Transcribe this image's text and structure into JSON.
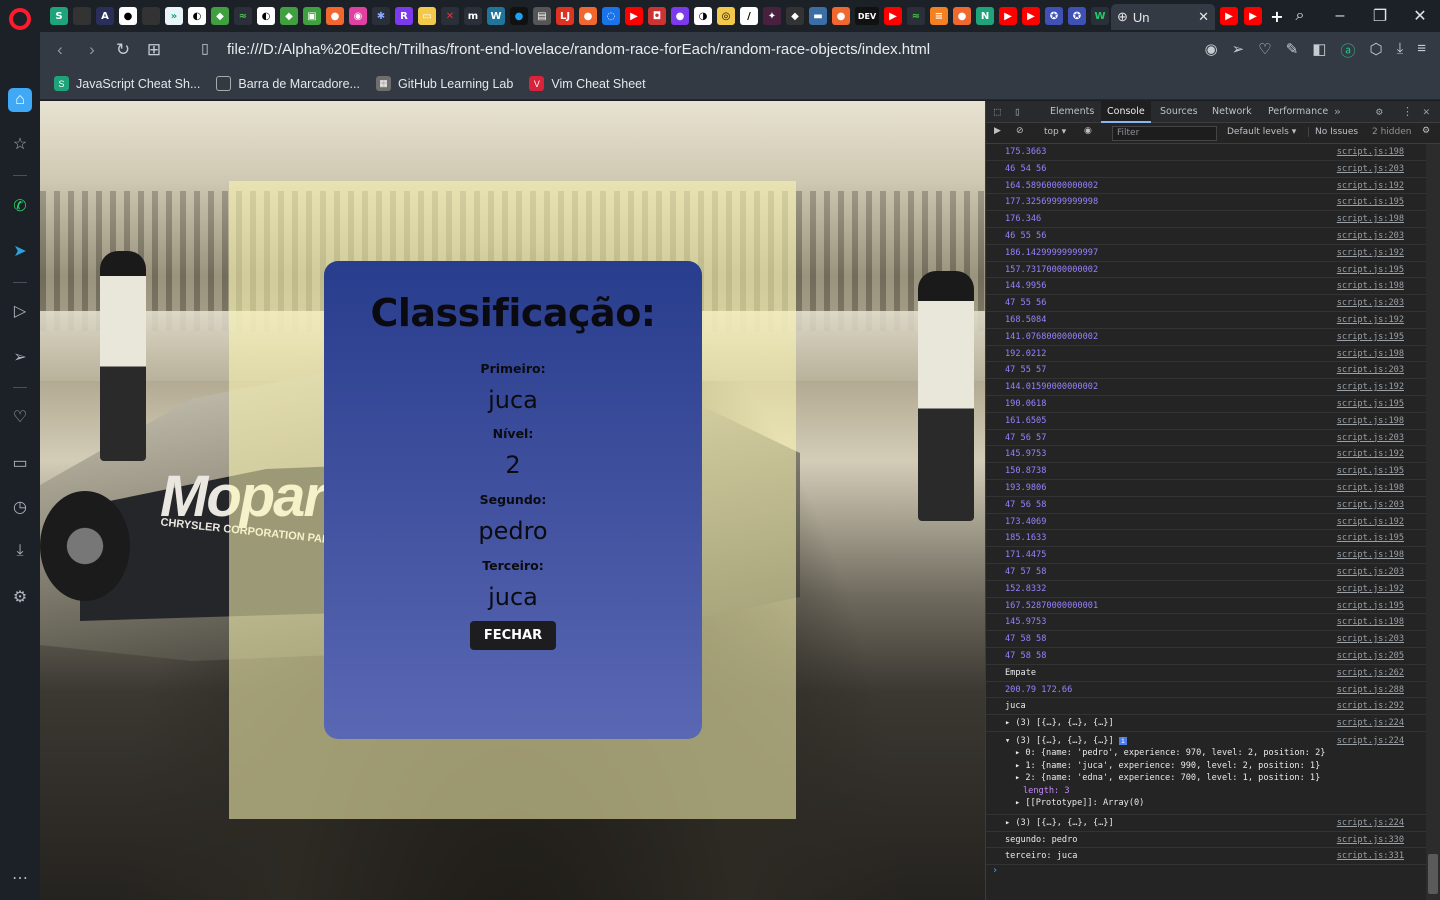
{
  "browser": {
    "active_tab_title": "Un",
    "url": "file:///D:/Alpha%20Edtech/Trilhas/front-end-lovelace/random-race-forEach/random-race-objects/index.html",
    "bookmarks": [
      {
        "label": "JavaScript Cheat Sh...",
        "color": "#1fa37a",
        "icon": "S"
      },
      {
        "label": "Barra de Marcadore...",
        "color": "#5b616b",
        "icon": "▭"
      },
      {
        "label": "GitHub Learning Lab",
        "color": "#6e6e6e",
        "icon": "▦"
      },
      {
        "label": "Vim Cheat Sheet",
        "color": "#d8233b",
        "icon": "V"
      }
    ]
  },
  "modal": {
    "title": "Classificação:",
    "first_label": "Primeiro:",
    "first_value": "juca",
    "level_label": "Nível:",
    "level_value": "2",
    "second_label": "Segundo:",
    "second_value": "pedro",
    "third_label": "Terceiro:",
    "third_value": "juca",
    "close_label": "FECHAR"
  },
  "car_decal": {
    "brand": "Mopar",
    "sub": "CHRYSLER CORPORATION PARTS"
  },
  "devtools": {
    "tabs": [
      "Elements",
      "Console",
      "Sources",
      "Network",
      "Performance"
    ],
    "context": "top ▾",
    "filter_placeholder": "Filter",
    "levels": "Default levels ▾",
    "issues": "No Issues",
    "hidden": "2 hidden",
    "logs_top": [
      {
        "msg": "175.3663",
        "src": "script.js:198"
      },
      {
        "msg": "46 54 56",
        "src": "script.js:203"
      },
      {
        "msg": "164.58960000000002",
        "src": "script.js:192"
      },
      {
        "msg": "177.32569999999998",
        "src": "script.js:195"
      },
      {
        "msg": "176.346",
        "src": "script.js:198"
      },
      {
        "msg": "46 55 56",
        "src": "script.js:203"
      },
      {
        "msg": "186.14299999999997",
        "src": "script.js:192"
      },
      {
        "msg": "157.73170000000002",
        "src": "script.js:195"
      },
      {
        "msg": "144.9956",
        "src": "script.js:198"
      },
      {
        "msg": "47 55 56",
        "src": "script.js:203"
      },
      {
        "msg": "168.5084",
        "src": "script.js:192"
      },
      {
        "msg": "141.07680000000002",
        "src": "script.js:195"
      },
      {
        "msg": "192.0212",
        "src": "script.js:198"
      },
      {
        "msg": "47 55 57",
        "src": "script.js:203"
      },
      {
        "msg": "144.01590000000002",
        "src": "script.js:192"
      },
      {
        "msg": "190.0618",
        "src": "script.js:195"
      },
      {
        "msg": "161.6505",
        "src": "script.js:198"
      },
      {
        "msg": "47 56 57",
        "src": "script.js:203"
      },
      {
        "msg": "145.9753",
        "src": "script.js:192"
      },
      {
        "msg": "150.8738",
        "src": "script.js:195"
      },
      {
        "msg": "193.9806",
        "src": "script.js:198"
      },
      {
        "msg": "47 56 58",
        "src": "script.js:203"
      },
      {
        "msg": "173.4069",
        "src": "script.js:192"
      },
      {
        "msg": "185.1633",
        "src": "script.js:195"
      },
      {
        "msg": "171.4475",
        "src": "script.js:198"
      },
      {
        "msg": "47 57 58",
        "src": "script.js:203"
      },
      {
        "msg": "152.8332",
        "src": "script.js:192"
      },
      {
        "msg": "167.52870000000001",
        "src": "script.js:195"
      },
      {
        "msg": "145.9753",
        "src": "script.js:198"
      },
      {
        "msg": "47 58 58",
        "src": "script.js:203"
      },
      {
        "msg": "47 58 58",
        "src": "script.js:205"
      }
    ],
    "log_empate": {
      "msg": "Empate",
      "src": "script.js:262"
    },
    "log_totals": {
      "msg": "200.79 172.66",
      "src": "script.js:288"
    },
    "log_juca": {
      "msg": "juca",
      "src": "script.js:292"
    },
    "array_collapsed_1": {
      "msg": "▸ (3) [{…}, {…}, {…}]",
      "src": "script.js:224"
    },
    "array_expanded": {
      "header": "▾ (3) [{…}, {…}, {…}]",
      "src": "script.js:224",
      "items": [
        "▸ 0: {name: 'pedro', experience: 970, level: 2, position: 2}",
        "▸ 1: {name: 'juca', experience: 990, level: 2, position: 1}",
        "▸ 2: {name: 'edna', experience: 700, level: 1, position: 1}"
      ],
      "length": "length: 3",
      "prototype": "▸ [[Prototype]]: Array(0)"
    },
    "array_collapsed_2": {
      "msg": "▸ (3) [{…}, {…}, {…}]",
      "src": "script.js:224"
    },
    "log_segundo": {
      "msg": "segundo: pedro",
      "src": "script.js:330"
    },
    "log_terceiro": {
      "msg": "terceiro: juca",
      "src": "script.js:331"
    },
    "prompt": "›"
  }
}
